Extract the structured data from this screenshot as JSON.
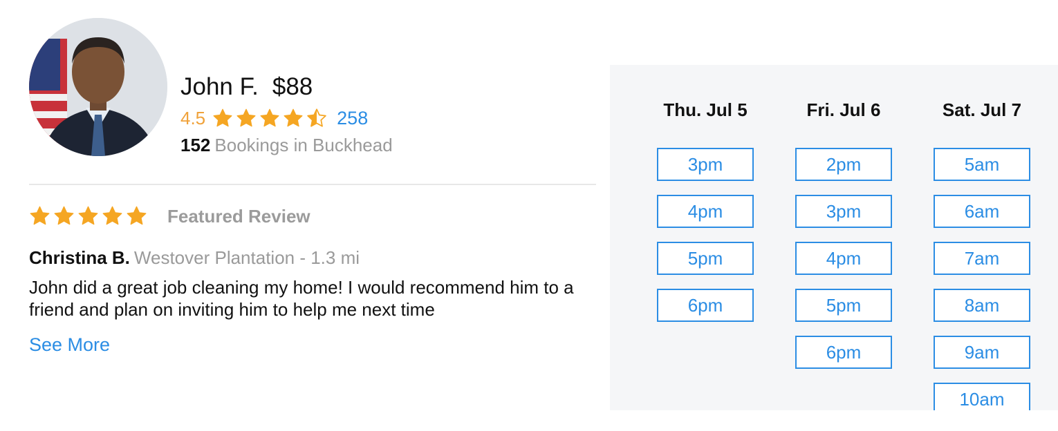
{
  "profile": {
    "name": "John F.",
    "price": "$88",
    "rating": "4.5",
    "rating_value": 4.5,
    "review_count": "258",
    "bookings_count": "152",
    "bookings_label": "Bookings in Buckhead"
  },
  "review": {
    "stars": 5,
    "featured_label": "Featured Review",
    "reviewer_name": "Christina B.",
    "reviewer_location": "Westover Plantation - 1.3 mi",
    "text": "John did a great job cleaning my home! I would recommend him to a friend and plan on inviting him to help me next time",
    "see_more_label": "See More"
  },
  "schedule": {
    "days": [
      {
        "label": "Thu. Jul 5",
        "slots": [
          "3pm",
          "4pm",
          "5pm",
          "6pm"
        ]
      },
      {
        "label": "Fri. Jul 6",
        "slots": [
          "2pm",
          "3pm",
          "4pm",
          "5pm",
          "6pm"
        ]
      },
      {
        "label": "Sat. Jul 7",
        "slots": [
          "5am",
          "6am",
          "7am",
          "8am",
          "9am",
          "10am"
        ]
      }
    ]
  },
  "colors": {
    "accent_blue": "#2b8de4",
    "star_orange": "#f5a623",
    "rating_text_orange": "#f0a23a",
    "muted_gray": "#9a9a9a",
    "panel_bg": "#f5f6f8"
  },
  "icons": {
    "avatar": "profile-photo",
    "star": "star-icon",
    "half_star": "half-star-icon"
  }
}
